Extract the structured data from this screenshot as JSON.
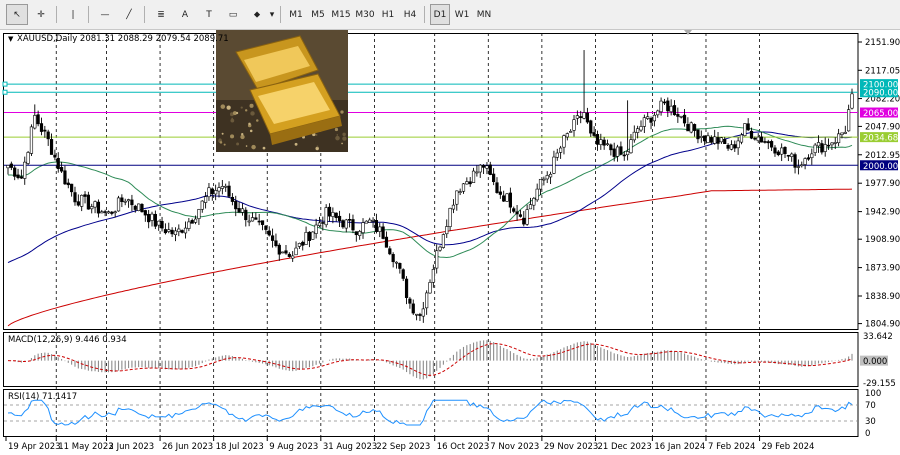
{
  "toolbar": {
    "tools": [
      {
        "name": "cursor-icon",
        "glyph": "↖",
        "active": true
      },
      {
        "name": "crosshair-icon",
        "glyph": "✛"
      },
      {
        "name": "vertical-line-icon",
        "glyph": "|"
      },
      {
        "name": "horizontal-line-icon",
        "glyph": "—"
      },
      {
        "name": "trendline-icon",
        "glyph": "╱"
      },
      {
        "name": "fibonacci-icon",
        "glyph": "≣"
      },
      {
        "name": "text-icon",
        "glyph": "A"
      },
      {
        "name": "text-label-icon",
        "glyph": "T"
      },
      {
        "name": "rectangle-icon",
        "glyph": "▭"
      },
      {
        "name": "shapes-icon",
        "glyph": "⬥"
      }
    ],
    "timeframes": [
      "M1",
      "M5",
      "M15",
      "M30",
      "H1",
      "H4",
      "D1",
      "W1",
      "MN"
    ],
    "active_timeframe": "D1"
  },
  "chart_header": {
    "symbol": "XAUUSD,Daily",
    "ohlc": "2081.31 2088.29 2079.54 2089.71"
  },
  "chart_data": {
    "type": "candlestick",
    "price_axis": {
      "ylim": [
        1797,
        2163
      ],
      "ticks": [
        "2151.90",
        "2117.05",
        "2082.20",
        "2047.90",
        "2012.95",
        "1977.90",
        "1942.90",
        "1908.90",
        "1873.90",
        "1838.90",
        "1804.90"
      ]
    },
    "level_lines": [
      {
        "price": 2100.0,
        "label": "2100.00",
        "color": "#00b8b8"
      },
      {
        "price": 2090.0,
        "label": "2090.00",
        "color": "#00b8b8"
      },
      {
        "price": 2065.0,
        "label": "2065.00",
        "color": "#e000e0"
      },
      {
        "price": 2034.68,
        "label": "2034.68",
        "color": "#9acd32"
      },
      {
        "price": 2000.0,
        "label": "2000.00",
        "color": "#000080"
      }
    ],
    "ma_colors": {
      "ma50": "#2e8b57",
      "ma100": "#00008b",
      "ma200": "#cc0000"
    },
    "anchors": [
      [
        0,
        2000
      ],
      [
        4,
        1985
      ],
      [
        8,
        2060
      ],
      [
        12,
        2030
      ],
      [
        16,
        1990
      ],
      [
        20,
        1960
      ],
      [
        25,
        1950
      ],
      [
        30,
        1940
      ],
      [
        35,
        1960
      ],
      [
        40,
        1945
      ],
      [
        45,
        1925
      ],
      [
        50,
        1915
      ],
      [
        55,
        1935
      ],
      [
        60,
        1965
      ],
      [
        64,
        1975
      ],
      [
        68,
        1950
      ],
      [
        72,
        1935
      ],
      [
        76,
        1920
      ],
      [
        80,
        1900
      ],
      [
        85,
        1890
      ],
      [
        90,
        1915
      ],
      [
        95,
        1940
      ],
      [
        100,
        1930
      ],
      [
        104,
        1922
      ],
      [
        108,
        1930
      ],
      [
        112,
        1915
      ],
      [
        116,
        1880
      ],
      [
        120,
        1830
      ],
      [
        123,
        1815
      ],
      [
        126,
        1860
      ],
      [
        130,
        1920
      ],
      [
        134,
        1970
      ],
      [
        138,
        1985
      ],
      [
        142,
        2000
      ],
      [
        146,
        1970
      ],
      [
        150,
        1955
      ],
      [
        154,
        1935
      ],
      [
        158,
        1970
      ],
      [
        162,
        1995
      ],
      [
        166,
        2030
      ],
      [
        170,
        2055
      ],
      [
        172,
        2065
      ],
      [
        174,
        2035
      ],
      [
        176,
        2025
      ],
      [
        180,
        2020
      ],
      [
        184,
        2010
      ],
      [
        188,
        2045
      ],
      [
        192,
        2060
      ],
      [
        196,
        2075
      ],
      [
        200,
        2065
      ],
      [
        204,
        2045
      ],
      [
        208,
        2035
      ],
      [
        212,
        2030
      ],
      [
        216,
        2020
      ],
      [
        220,
        2045
      ],
      [
        224,
        2035
      ],
      [
        228,
        2025
      ],
      [
        232,
        2015
      ],
      [
        236,
        2000
      ],
      [
        240,
        2020
      ],
      [
        244,
        2025
      ],
      [
        248,
        2035
      ],
      [
        250,
        2045
      ],
      [
        252,
        2088
      ]
    ],
    "date_labels": [
      {
        "i": 0,
        "label": "19 Apr 2023"
      },
      {
        "i": 15,
        "label": "11 May 2023"
      },
      {
        "i": 30,
        "label": "2 Jun 2023"
      },
      {
        "i": 46,
        "label": "26 Jun 2023"
      },
      {
        "i": 62,
        "label": "18 Jul 2023"
      },
      {
        "i": 78,
        "label": "9 Aug 2023"
      },
      {
        "i": 94,
        "label": "31 Aug 2023"
      },
      {
        "i": 110,
        "label": "22 Sep 2023"
      },
      {
        "i": 128,
        "label": "16 Oct 2023"
      },
      {
        "i": 144,
        "label": "7 Nov 2023"
      },
      {
        "i": 160,
        "label": "29 Nov 2023"
      },
      {
        "i": 176,
        "label": "21 Dec 2023"
      },
      {
        "i": 193,
        "label": "16 Jan 2024"
      },
      {
        "i": 209,
        "label": "7 Feb 2024"
      },
      {
        "i": 225,
        "label": "29 Feb 2024"
      }
    ],
    "macd": {
      "label": "MACD(12,26,9) 9.446 0.934",
      "ticks": [
        "33.642",
        "0.000",
        "-29.155"
      ],
      "range": [
        -35,
        38
      ],
      "hist_color": "#8b8b8b",
      "signal_color": "#cc0000"
    },
    "rsi": {
      "label": "RSI(14) 71.1417",
      "ticks": [
        "100",
        "70",
        "30",
        "0"
      ],
      "levels": [
        70,
        30
      ],
      "color": "#1e90ff"
    }
  },
  "colors": {
    "bull": "#000000",
    "bear": "#000000",
    "grid": "#000000",
    "axis_text": "#000000"
  },
  "thumbnail": {
    "name": "gold-bars-image"
  }
}
